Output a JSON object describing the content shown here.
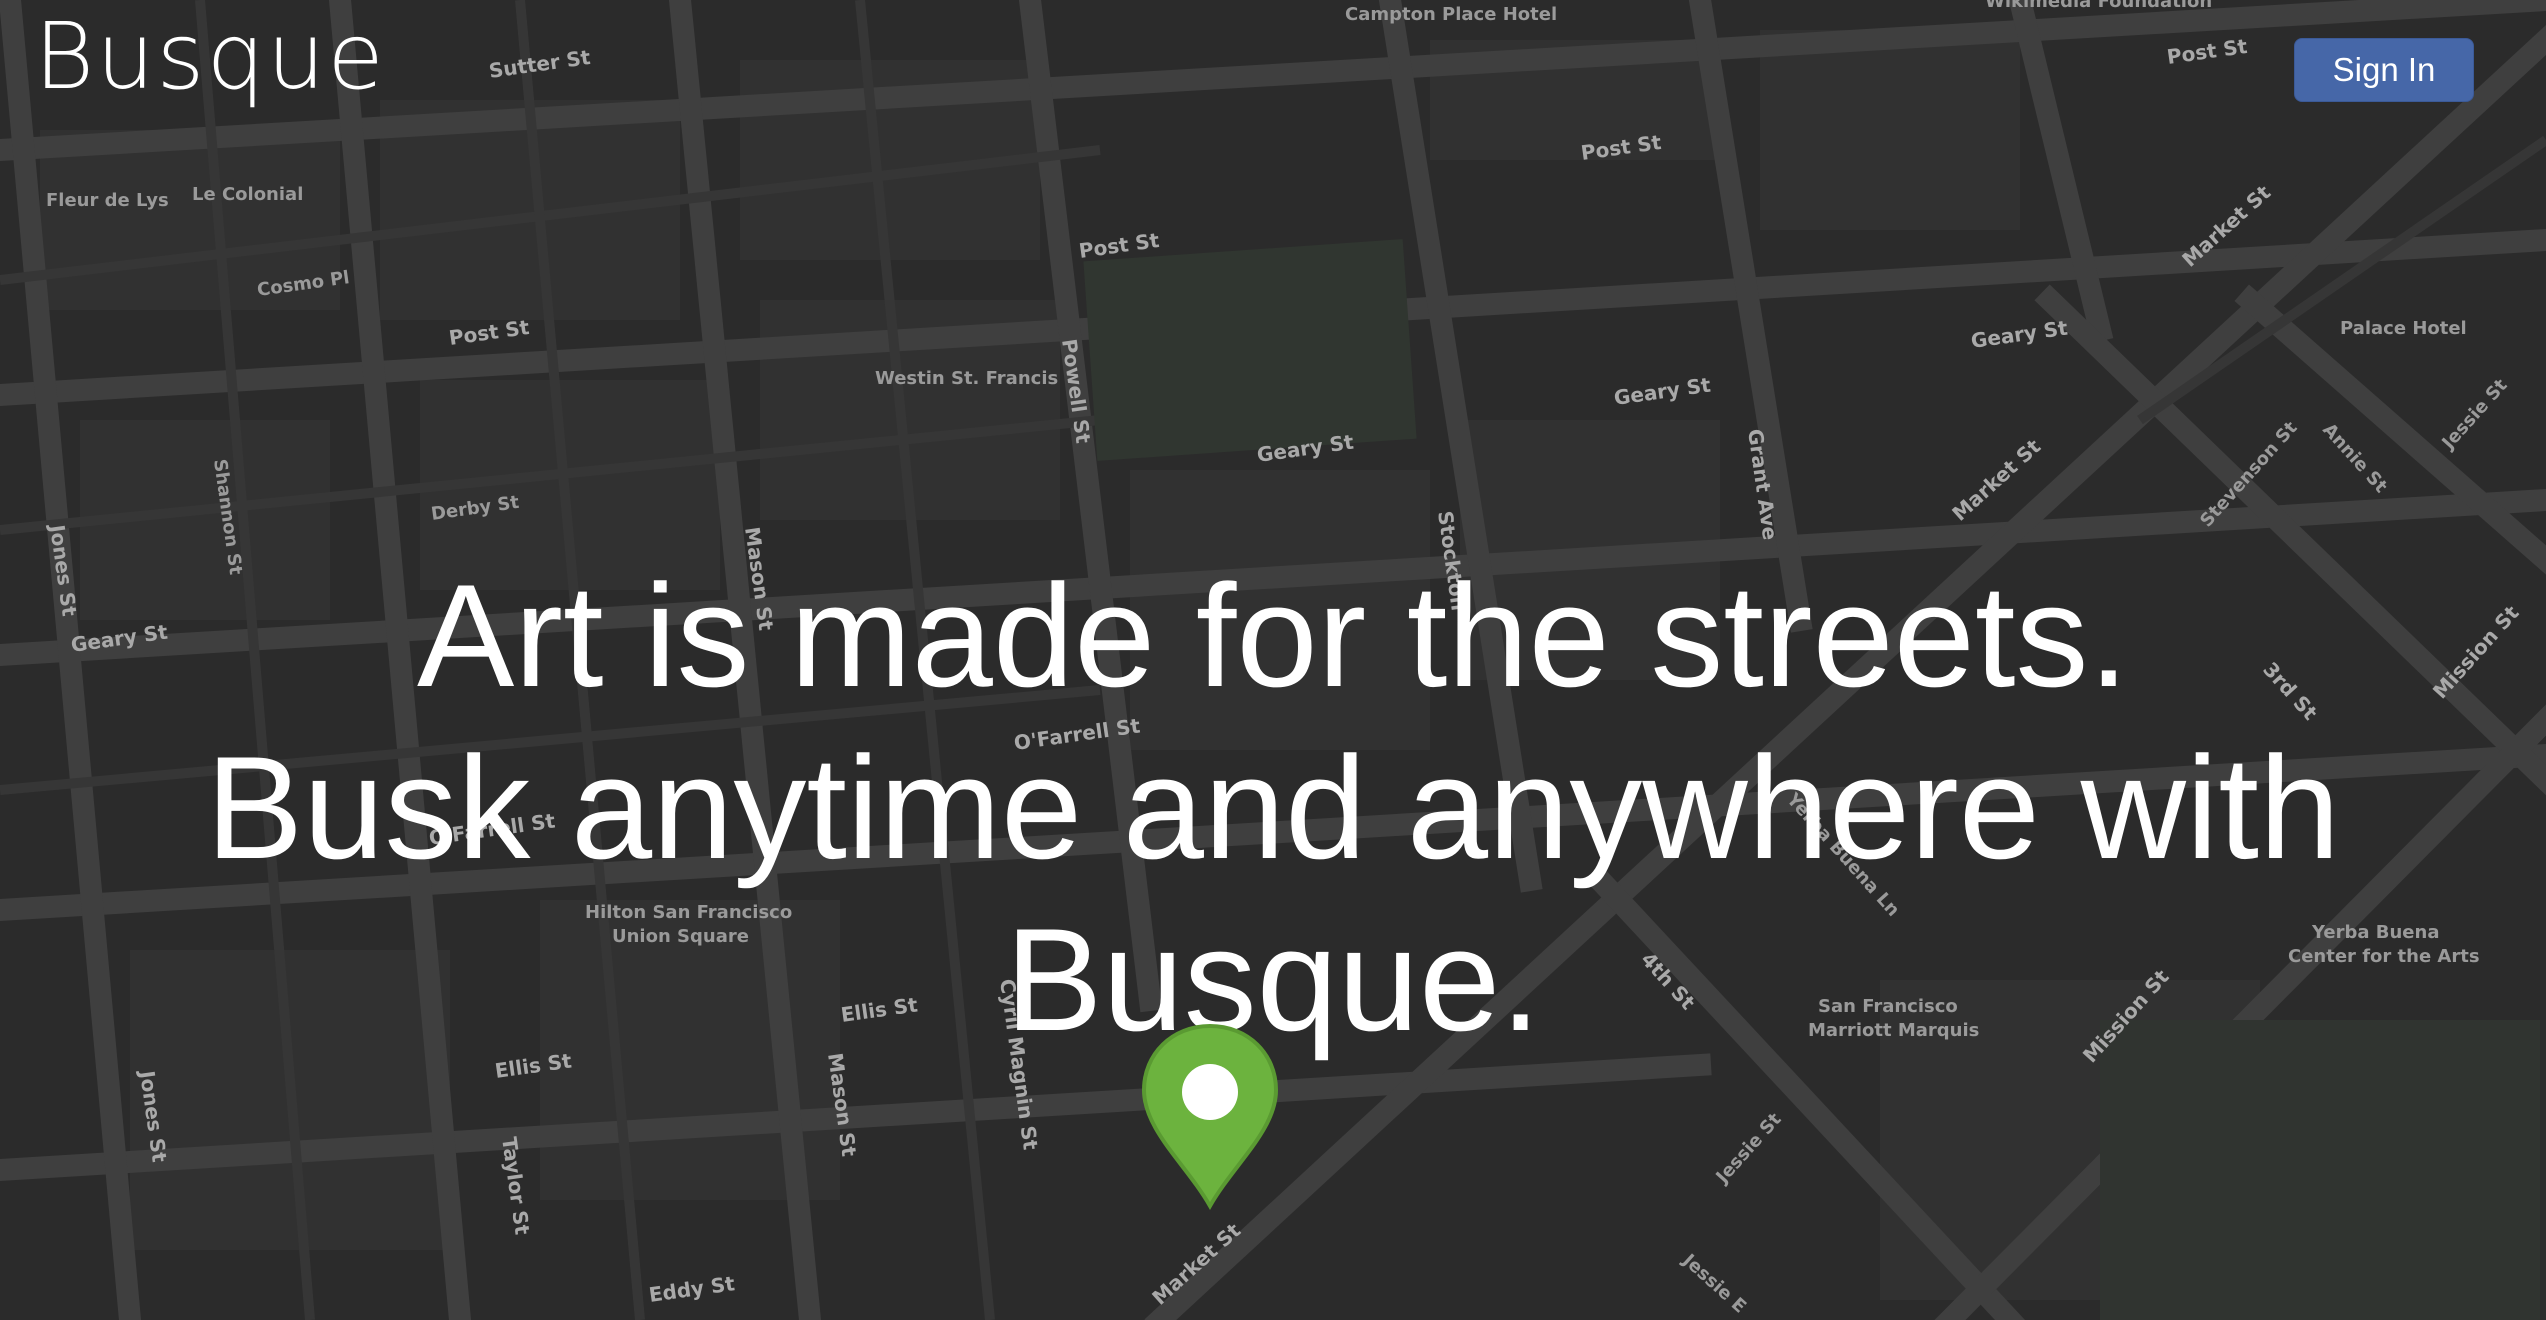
{
  "header": {
    "logo_text": "Busque",
    "sign_in_label": "Sign In"
  },
  "hero": {
    "line1": "Art is made for the streets.",
    "line2": "Busk anytime and anywhere with",
    "line3": "Busque."
  },
  "map": {
    "marker": "location-pin-icon",
    "colors": {
      "background": "#2b2b2b",
      "street": "#3e3e3e",
      "label": "#a9a9a9",
      "marker": "#6cb33e",
      "button": "#4667a8"
    },
    "labels": {
      "sutter": "Sutter St",
      "campton": "Campton Place Hotel",
      "wikimedia": "Wikimedia Foundation",
      "post1": "Post St",
      "post2": "Post St",
      "post3": "Post St",
      "post4": "Post St",
      "fleur": "Fleur de Lys",
      "colonial": "Le Colonial",
      "cosmo": "Cosmo Pl",
      "westin": "Westin St. Francis",
      "powell": "Powell St",
      "geary1": "Geary St",
      "geary2": "Geary St",
      "geary3": "Geary St",
      "geary4": "Geary St",
      "grant": "Grant Ave",
      "market1": "Market St",
      "market2": "Market St",
      "market3": "Market St",
      "palace": "Palace Hotel",
      "annie": "Annie St",
      "jessie1": "Jessie St",
      "jessie2": "Jessie St",
      "jessie3": "Jessie E",
      "stevenson": "Stevenson St",
      "mission1": "Mission St",
      "mission2": "Mission St",
      "third": "3rd St",
      "fourth": "4th St",
      "shannon": "Shannon St",
      "jones1": "Jones St",
      "jones2": "Jones St",
      "derby": "Derby St",
      "mason1": "Mason St",
      "mason2": "Mason St",
      "stockton": "Stockton",
      "ofarrell1": "O'Farrell St",
      "ofarrell2": "O'Farrell St",
      "hilton": "Hilton San Francisco\nUnion Square",
      "ellis1": "Ellis St",
      "ellis2": "Ellis St",
      "cyril": "Cyril Magnin St",
      "taylor": "Taylor St",
      "eddy": "Eddy St",
      "marriott": "San Francisco\nMarriott Marquis",
      "yerba": "Yerba Buena\nCenter for the Arts",
      "yerbaln": "Yerba Buena Ln"
    }
  }
}
